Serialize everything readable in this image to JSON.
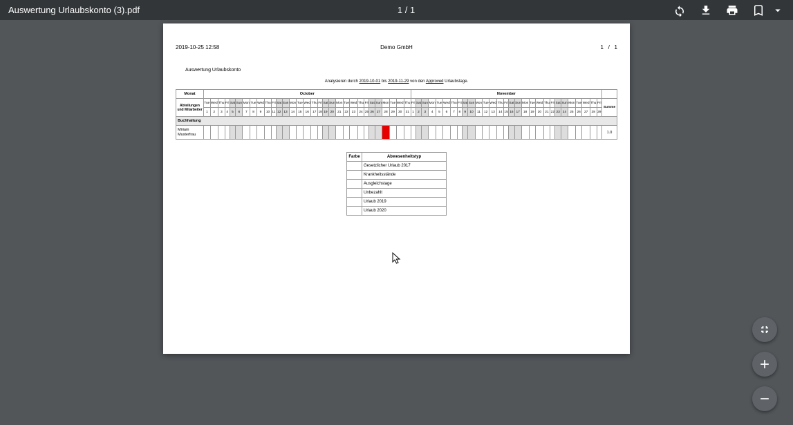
{
  "toolbar": {
    "title": "Auswertung Urlaubskonto (3).pdf",
    "page_indicator": "1 / 1"
  },
  "doc": {
    "timestamp": "2019-10-25 12:58",
    "company": "Demo GmbH",
    "page_current": "1",
    "page_sep": "/",
    "page_total": "1",
    "report_title": "Auswertung Urlaubskonto",
    "analyze_prefix": "Analysieren durch ",
    "date_from": "2019-10-01",
    "mid": " bis ",
    "date_to": "2019-11-29",
    "after": " von den ",
    "approved": "Approved",
    "tail": " Urlaubstage.",
    "monat_label": "Monat",
    "october": "October",
    "november": "November",
    "summe_label": "Summe",
    "dept": "Abteilungen und Mitarbeiter",
    "dept_name": "Buchhaltung",
    "emp_name": "Miriam Musterfrau",
    "emp_sum": "1.0",
    "legend_farbe": "Farbe",
    "legend_head": "Abwesenheitstyp",
    "legend": [
      "Gesetzlicher Urlaub 2017",
      "Krankheitsstände",
      "Ausgleichstage",
      "Unbezahlt",
      "Urlaub 2019",
      "Urlaub 2020"
    ]
  },
  "cal": {
    "oct_dow": [
      "Tue",
      "Wed",
      "Thu",
      "Fri",
      "Sat",
      "Sun",
      "Mon",
      "Tue",
      "Wed",
      "Thu",
      "Fri",
      "Sat",
      "Sun",
      "Mon",
      "Tue",
      "Wed",
      "Thu",
      "Fri",
      "Sat",
      "Sun",
      "Mon",
      "Tue",
      "Wed",
      "Thu",
      "Fri",
      "Sat",
      "Sun",
      "Mon",
      "Tue",
      "Wed",
      "Thu"
    ],
    "oct_days": [
      "1",
      "2",
      "3",
      "4",
      "5",
      "6",
      "7",
      "8",
      "9",
      "10",
      "11",
      "12",
      "13",
      "14",
      "15",
      "16",
      "17",
      "18",
      "19",
      "20",
      "21",
      "22",
      "23",
      "24",
      "25",
      "26",
      "27",
      "28",
      "29",
      "30",
      "31"
    ],
    "oct_we": [
      0,
      0,
      0,
      0,
      1,
      1,
      0,
      0,
      0,
      0,
      0,
      1,
      1,
      0,
      0,
      0,
      0,
      0,
      1,
      1,
      0,
      0,
      0,
      0,
      0,
      1,
      1,
      0,
      0,
      0,
      0
    ],
    "nov_dow": [
      "Fri",
      "Sat",
      "Sun",
      "Mon",
      "Tue",
      "Wed",
      "Thu",
      "Fri",
      "Sat",
      "Sun",
      "Mon",
      "Tue",
      "Wed",
      "Thu",
      "Fri",
      "Sat",
      "Sun",
      "Mon",
      "Tue",
      "Wed",
      "Thu",
      "Fri",
      "Sat",
      "Sun",
      "Mon",
      "Tue",
      "Wed",
      "Thu",
      "Fri"
    ],
    "nov_days": [
      "1",
      "2",
      "3",
      "4",
      "5",
      "6",
      "7",
      "8",
      "9",
      "10",
      "11",
      "12",
      "13",
      "14",
      "15",
      "16",
      "17",
      "18",
      "19",
      "20",
      "21",
      "22",
      "23",
      "24",
      "25",
      "26",
      "27",
      "28",
      "29"
    ],
    "nov_we": [
      0,
      1,
      1,
      0,
      0,
      0,
      0,
      0,
      1,
      1,
      0,
      0,
      0,
      0,
      0,
      1,
      1,
      0,
      0,
      0,
      0,
      0,
      1,
      1,
      0,
      0,
      0,
      0,
      0
    ],
    "mark_oct_idx": 27
  }
}
